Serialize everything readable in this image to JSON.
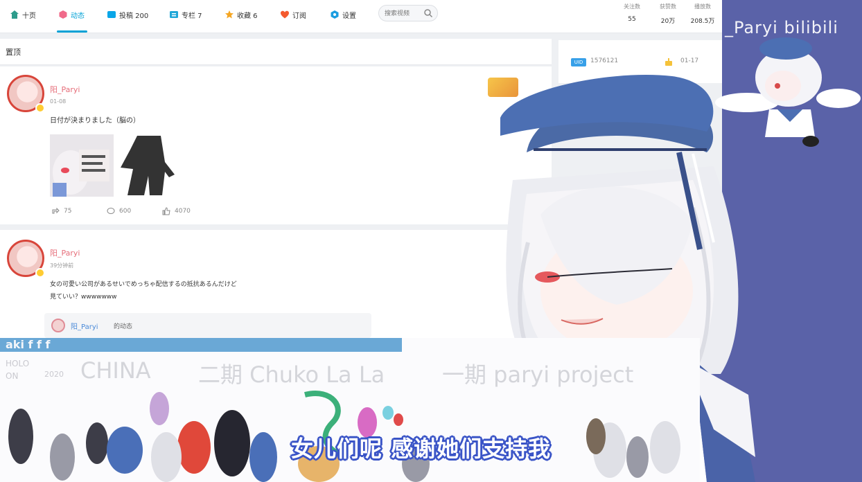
{
  "nav": {
    "items": [
      {
        "label": "十页",
        "icon": "home-icon",
        "color": "#2e9c8c"
      },
      {
        "label": "动态",
        "icon": "activity-icon",
        "color": "#f06a8a",
        "active": true
      },
      {
        "label": "投稿 200",
        "icon": "video-icon",
        "color": "#0aa6e8"
      },
      {
        "label": "专栏 7",
        "icon": "article-icon",
        "color": "#20a7d8"
      },
      {
        "label": "收藏 6",
        "icon": "star-icon",
        "color": "#f5a623"
      },
      {
        "label": "订阅",
        "icon": "heart-icon",
        "color": "#f45a2e"
      },
      {
        "label": "设置",
        "icon": "settings-icon",
        "color": "#1a9de0"
      }
    ],
    "search_placeholder": "搜索视频"
  },
  "stats": [
    {
      "label": "关注数",
      "value": "55"
    },
    {
      "label": "获赞数",
      "value": "20万"
    },
    {
      "label": "播放数",
      "value": "208.5万"
    }
  ],
  "section_title": "置顶",
  "posts": [
    {
      "username": "阳_Paryi",
      "time": "01-08",
      "text": "日付が決まりました（脳の）",
      "repost": "75",
      "comment": "600",
      "like": "4070"
    },
    {
      "username": "阳_Paryi",
      "time": "39分钟前",
      "text_line1": "女の可愛い公司があるせいでめっちゃ配信するの抵抗あるんだけど",
      "text_line2": "見ていい？wwwwwww",
      "repost_user": "阳_Paryi",
      "repost_tag": "的动态"
    }
  ],
  "side_card": {
    "uid_tag": "UID",
    "uid": "1576121",
    "birthday": "01-17"
  },
  "watermark": "_Paryi bilibili",
  "bottom": {
    "top_text": "aki f f f",
    "holo_line1": "HOLO",
    "holo_line2": "ON",
    "year": "2020",
    "ghost_1": "CHINA",
    "ghost_2": "二期 Chuko La La",
    "ghost_3": "一期 paryi project"
  },
  "subtitle": "女儿们呢 感谢她们支持我",
  "colors": {
    "accent": "#00a1d6",
    "subtitle_outline": "#3a54c7",
    "background": "#5a62a8"
  }
}
